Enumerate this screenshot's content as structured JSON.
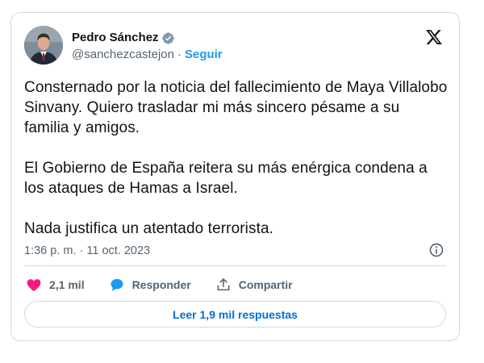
{
  "tweet": {
    "author": {
      "name": "Pedro Sánchez",
      "handle": "@sanchezcastejon",
      "follow_label": "Seguir"
    },
    "paragraphs": [
      "Consternado por la noticia del fallecimiento de Maya Villalobo Sinvany. Quiero trasladar mi más sincero pésame a su familia y amigos.",
      "El Gobierno de España reitera su más enérgica condena a los ataques de Hamas a Israel.",
      "Nada justifica un atentado terrorista."
    ],
    "timestamp": "1:36 p. m. · 11 oct. 2023"
  },
  "actions": {
    "likes": "2,1 mil",
    "reply_label": "Responder",
    "share_label": "Compartir"
  },
  "replies_button": "Leer 1,9 mil respuestas",
  "colors": {
    "accent": "#1d9bf0",
    "like": "#f91880",
    "text": "#0f1419",
    "muted": "#536471",
    "border": "#cfd9de"
  },
  "icons": [
    "verified-badge-icon",
    "x-logo-icon",
    "info-icon",
    "heart-icon",
    "reply-bubble-icon",
    "share-icon"
  ]
}
